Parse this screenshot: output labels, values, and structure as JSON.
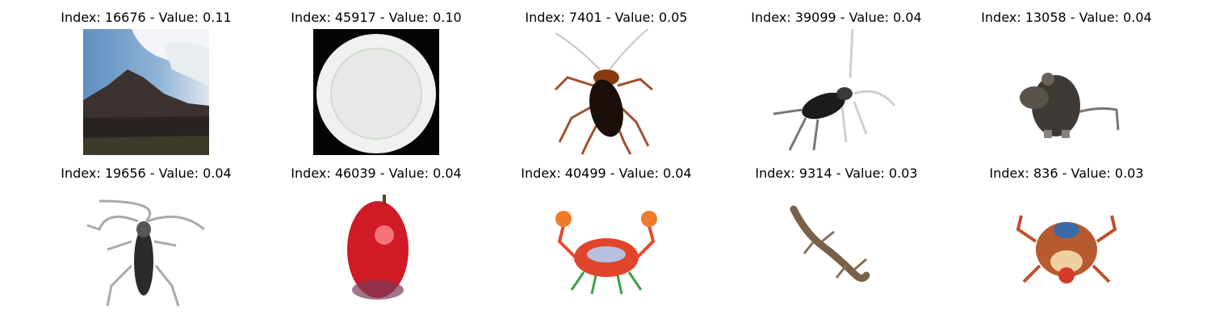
{
  "grid": {
    "items": [
      {
        "index": "16676",
        "value": "0.11",
        "title": "Index: 16676 - Value: 0.11",
        "subject": "mountain"
      },
      {
        "index": "45917",
        "value": "0.10",
        "title": "Index: 45917 - Value: 0.10",
        "subject": "plate"
      },
      {
        "index": "7401",
        "value": "0.05",
        "title": "Index: 7401 - Value: 0.05",
        "subject": "cockroach"
      },
      {
        "index": "39099",
        "value": "0.04",
        "title": "Index: 39099 - Value: 0.04",
        "subject": "insect"
      },
      {
        "index": "13058",
        "value": "0.04",
        "title": "Index: 13058 - Value: 0.04",
        "subject": "mouse"
      },
      {
        "index": "19656",
        "value": "0.04",
        "title": "Index: 19656 - Value: 0.04",
        "subject": "beetle"
      },
      {
        "index": "46039",
        "value": "0.04",
        "title": "Index: 46039 - Value: 0.04",
        "subject": "apple"
      },
      {
        "index": "40499",
        "value": "0.04",
        "title": "Index: 40499 - Value: 0.04",
        "subject": "crab"
      },
      {
        "index": "9314",
        "value": "0.03",
        "title": "Index: 9314 - Value: 0.03",
        "subject": "lizard"
      },
      {
        "index": "836",
        "value": "0.03",
        "title": "Index: 836 - Value: 0.03",
        "subject": "crab"
      }
    ]
  }
}
